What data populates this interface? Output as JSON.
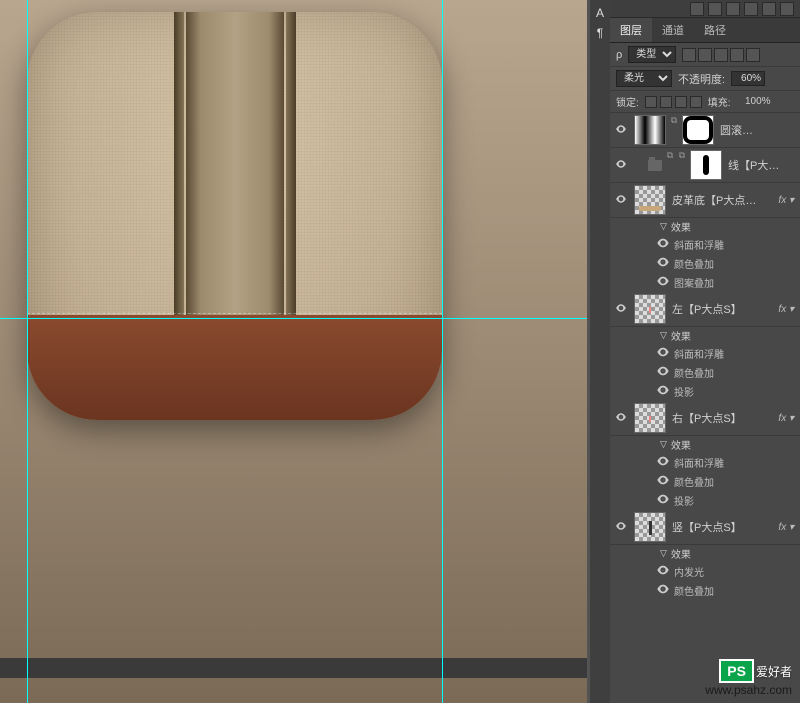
{
  "tabs": {
    "layers": "图层",
    "channels": "通道",
    "paths": "路径"
  },
  "filter": {
    "label": "类型",
    "icons": 5
  },
  "blend": {
    "mode": "柔光",
    "opacity_label": "不透明度:",
    "opacity": "60%"
  },
  "lock": {
    "label": "锁定:",
    "fill_label": "填充:",
    "fill": "100%"
  },
  "layers": [
    {
      "kind": "layer",
      "name": "圆滚…",
      "thumb": "grad",
      "mask": "white-sq",
      "vis": true
    },
    {
      "kind": "group",
      "name": "线【P大…",
      "thumb": "folder",
      "mask": "stripe",
      "vis": true
    },
    {
      "kind": "layer",
      "name": "皮革底【P大点…",
      "thumb": "checker",
      "content": "bar",
      "fx": true,
      "vis": true,
      "fxs": [
        "效果",
        "斜面和浮雕",
        "颜色叠加",
        "图案叠加"
      ]
    },
    {
      "kind": "layer",
      "name": "左【P大点S】",
      "thumb": "checker",
      "content": "pink",
      "fx": true,
      "vis": true,
      "fxs": [
        "效果",
        "斜面和浮雕",
        "颜色叠加",
        "投影"
      ]
    },
    {
      "kind": "layer",
      "name": "右【P大点S】",
      "thumb": "checker",
      "content": "pink",
      "fx": true,
      "vis": true,
      "fxs": [
        "效果",
        "斜面和浮雕",
        "颜色叠加",
        "投影"
      ]
    },
    {
      "kind": "layer",
      "name": "竖【P大点S】",
      "thumb": "checker",
      "content": "stripe",
      "fx": true,
      "vis": true,
      "fxs": [
        "效果",
        "内发光",
        "颜色叠加"
      ]
    }
  ],
  "watermark": {
    "logo": "PS",
    "text": "爱好者",
    "url": "www.psahz.com"
  }
}
